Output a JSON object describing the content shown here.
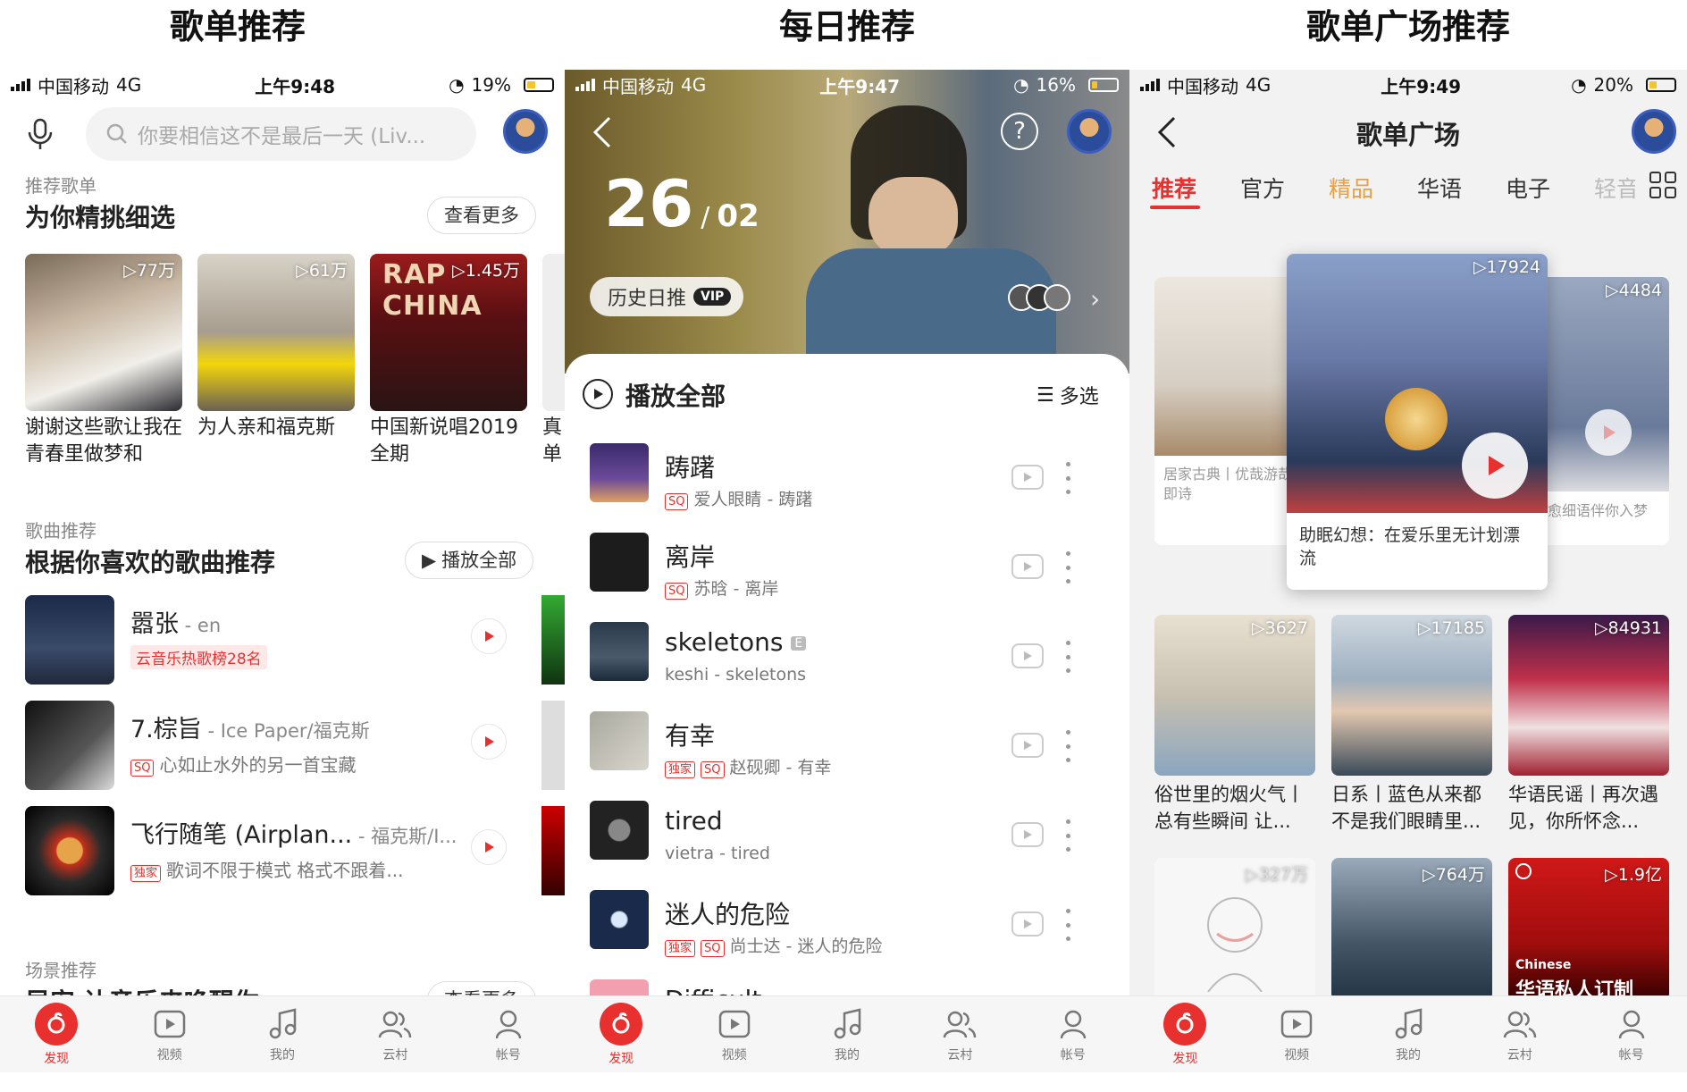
{
  "captions": [
    "歌单推荐",
    "每日推荐",
    "歌单广场推荐"
  ],
  "colors": {
    "accent": "#e8312f",
    "text": "#222222",
    "sub": "#888888"
  },
  "panel1": {
    "status": {
      "carrier": "中国移动",
      "network": "4G",
      "time": "上午9:48",
      "battery": "19%"
    },
    "search_placeholder": "你要相信这不是最后一天 (Liv...",
    "sec1": {
      "small": "推荐歌单",
      "title": "为你精挑细选",
      "more": "查看更多"
    },
    "playlists": [
      {
        "count": "▷77万",
        "title": "谢谢这些歌让我在青春里做梦和"
      },
      {
        "count": "▷61万",
        "title": "为人亲和福克斯"
      },
      {
        "count": "▷1.45万",
        "title": "中国新说唱2019全期"
      },
      {
        "count": "",
        "title": "真单"
      }
    ],
    "sec2": {
      "small": "歌曲推荐",
      "title": "根据你喜欢的歌曲推荐",
      "play": "播放全部"
    },
    "songs": [
      {
        "title": "嚣张",
        "artist": " - en",
        "sub": "云音乐热歌榜28名",
        "tag": ""
      },
      {
        "title": "7.棕旨",
        "artist": " - Ice Paper/福克斯",
        "sub": "心如止水外的另一首宝藏",
        "tag": "SQ"
      },
      {
        "title": "飞行随笔 (Airplan...",
        "artist": " - 福克斯/I...",
        "sub": "歌词不限于模式 格式不跟着...",
        "tag": "独家"
      }
    ],
    "sec3": {
      "small": "场景推荐",
      "title": "早安 让音乐来唤醒你",
      "more": "查看更多"
    }
  },
  "panel2": {
    "status": {
      "carrier": "中国移动",
      "network": "4G",
      "time": "上午9:47",
      "battery": "16%"
    },
    "day": "26",
    "month": "02",
    "history": "历史日推",
    "vip": "VIP",
    "play_all": "播放全部",
    "multi": "多选",
    "songs": [
      {
        "title": "踌躇",
        "tags": [
          "SQ"
        ],
        "sub": "爱人眼睛 - 踌躇"
      },
      {
        "title": "离岸",
        "tags": [
          "SQ"
        ],
        "sub": "苏晗 - 离岸"
      },
      {
        "title": "skeletons",
        "tags": [],
        "sub": "keshi - skeletons",
        "badge": "E"
      },
      {
        "title": "有幸",
        "tags": [
          "独家",
          "SQ"
        ],
        "sub": "赵砚卿 - 有幸"
      },
      {
        "title": "tired",
        "tags": [],
        "sub": "vietra - tired"
      },
      {
        "title": "迷人的危险",
        "tags": [
          "独家",
          "SQ"
        ],
        "sub": "尚士达 - 迷人的危险"
      },
      {
        "title": "Difficult",
        "tags": [],
        "sub": ""
      }
    ]
  },
  "panel3": {
    "status": {
      "carrier": "中国移动",
      "network": "4G",
      "time": "上午9:49",
      "battery": "20%"
    },
    "title": "歌单广场",
    "tabs": [
      "推荐",
      "官方",
      "精品",
      "华语",
      "电子",
      "轻音"
    ],
    "carousel": {
      "left": {
        "title": "居家古典丨优哉游哉即诗"
      },
      "center": {
        "count": "▷17924",
        "title": "助眠幻想：在爱乐里无计划漂流"
      },
      "right": {
        "count": "▷4484",
        "title": "治愈细语伴你入梦"
      }
    },
    "grid": [
      {
        "count": "▷3627",
        "title": "俗世里的烟火气丨总有些瞬间 让..."
      },
      {
        "count": "▷17185",
        "title": "日系丨蓝色从来都不是我们眼睛里..."
      },
      {
        "count": "▷84931",
        "title": "华语民谣丨再次遇见，你所怀念..."
      },
      {
        "count": "▷327万",
        "title": ""
      },
      {
        "count": "▷764万",
        "title": ""
      },
      {
        "count": "▷1.9亿",
        "title": "华语私人订制",
        "overlay": "Chinese"
      }
    ]
  },
  "tabbar": [
    "发现",
    "视频",
    "我的",
    "云村",
    "帐号"
  ]
}
